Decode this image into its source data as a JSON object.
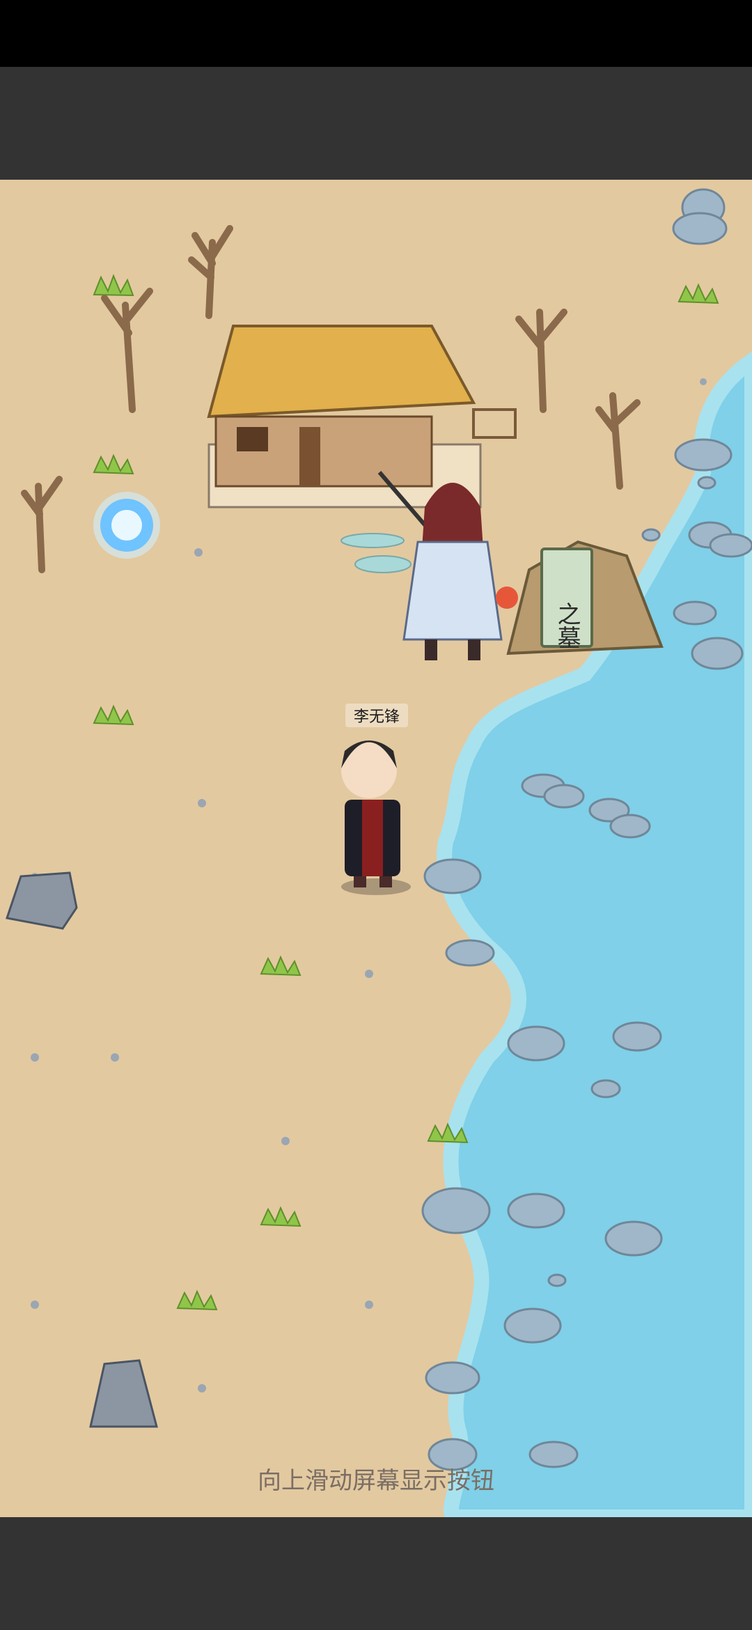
{
  "scene": {
    "npc_name": "李无锋",
    "swipe_hint": "向上滑动屏幕显示按钮",
    "tomb_inscription": "之墓",
    "colors": {
      "sand": "#e3c9a0",
      "water": "#7fd0e8",
      "water_edge": "#a8e2ef",
      "rock": "#9fb7c9",
      "grass": "#8fc64a",
      "top_bar": "#333333",
      "bottom_bar": "#333333"
    }
  },
  "icons": [
    "portal-icon",
    "house-icon",
    "tomb-icon",
    "tree-icon",
    "rock-icon",
    "grass-icon"
  ]
}
